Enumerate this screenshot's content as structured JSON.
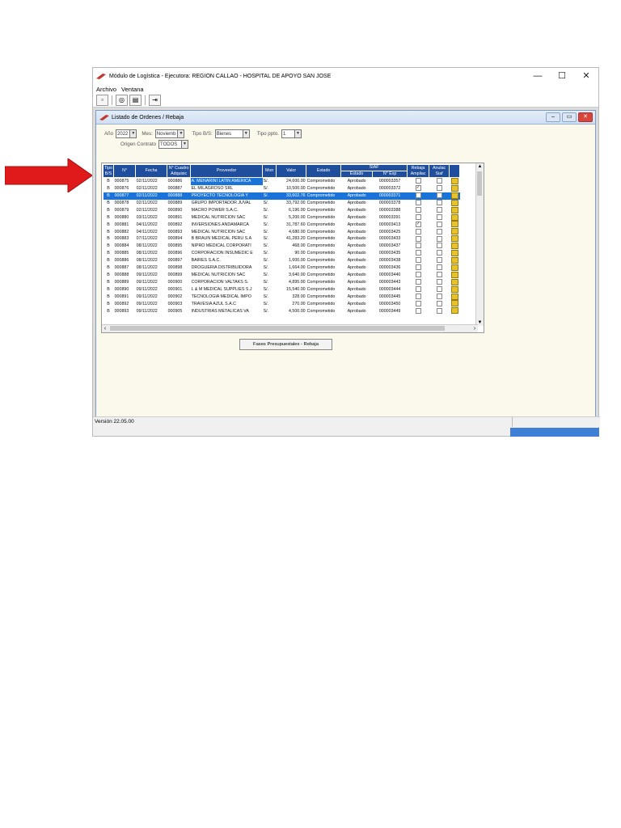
{
  "window": {
    "title": "Módulo de Logística - Ejecutora: REGION CALLAO - HOSPITAL DE APOYO SAN JOSE",
    "minimize": "—",
    "maximize": "☐",
    "close": "✕"
  },
  "menu": {
    "archivo": "Archivo",
    "ventana": "Ventana"
  },
  "child": {
    "title": "Listado de Ordenes / Rebaja"
  },
  "filters": {
    "anio_label": "Año",
    "anio_value": "2022",
    "mes_label": "Mes:",
    "mes_value": "Noviemb",
    "tipo_bs_label": "Tipo  B/S:",
    "tipo_bs_value": "Bienes",
    "tipo_ppto_label": "Tipo ppto.",
    "tipo_ppto_value": "1",
    "origen_label": "Origen Contrato",
    "origen_value": "TODOS"
  },
  "columns": {
    "tipo": "Tipo B/S",
    "numero": "N°",
    "fecha": "Fecha",
    "cuadro": "N° Cuadro Adquisic",
    "proveedor": "Proveedor",
    "mon": "Mon",
    "valor": "Valor",
    "estado": "Estado",
    "siaf": "SIAF",
    "siaf_estado": "Estado",
    "siaf_exp": "N° Exp",
    "rebaja": "Rebaja Ampliac",
    "anulac": "Anulac Siaf"
  },
  "rows": [
    {
      "tipo": "B",
      "num": "000875",
      "fecha": "02/11/2022",
      "cuadro": "000886",
      "prov": "A. MENARINI LATIN AMERICA",
      "mon": "S/.",
      "valor": "24,600.00",
      "estado": "Comprometido",
      "siaf_estado": "Aprobado",
      "exp": "000003357",
      "rebaja": false,
      "anulac": false
    },
    {
      "tipo": "B",
      "num": "000876",
      "fecha": "02/11/2022",
      "cuadro": "000887",
      "prov": "EL MILAGROSO SRL",
      "mon": "S/.",
      "valor": "10,500.00",
      "estado": "Comprometido",
      "siaf_estado": "Aprobado",
      "exp": "000003372",
      "rebaja": true,
      "anulac": false
    },
    {
      "tipo": "B",
      "num": "000877",
      "fecha": "02/11/2022",
      "cuadro": "000888",
      "prov": "PROYECTO TECNOLOGIA Y",
      "mon": "S/.",
      "valor": "33,602.76",
      "estado": "Comprometido",
      "siaf_estado": "Aprobado",
      "exp": "000003371",
      "rebaja": false,
      "anulac": false
    },
    {
      "tipo": "B",
      "num": "000878",
      "fecha": "02/11/2022",
      "cuadro": "000889",
      "prov": "GRUPO IMPORTADOR JUVAL",
      "mon": "S/.",
      "valor": "33,792.00",
      "estado": "Comprometido",
      "siaf_estado": "Aprobado",
      "exp": "000003378",
      "rebaja": false,
      "anulac": false
    },
    {
      "tipo": "B",
      "num": "000879",
      "fecha": "02/11/2022",
      "cuadro": "000890",
      "prov": "MACRO POWER S.A.C.",
      "mon": "S/.",
      "valor": "6,196.00",
      "estado": "Comprometido",
      "siaf_estado": "Aprobado",
      "exp": "000003388",
      "rebaja": false,
      "anulac": false
    },
    {
      "tipo": "B",
      "num": "000880",
      "fecha": "03/11/2022",
      "cuadro": "000891",
      "prov": "MEDICAL NUTRICION SAC",
      "mon": "S/.",
      "valor": "5,200.00",
      "estado": "Comprometido",
      "siaf_estado": "Aprobado",
      "exp": "000003391",
      "rebaja": false,
      "anulac": false
    },
    {
      "tipo": "B",
      "num": "000881",
      "fecha": "04/11/2022",
      "cuadro": "000892",
      "prov": "INVERSIONES ANDAMARCA",
      "mon": "S/.",
      "valor": "31,787.60",
      "estado": "Comprometido",
      "siaf_estado": "Aprobado",
      "exp": "000003413",
      "rebaja": true,
      "anulac": false
    },
    {
      "tipo": "B",
      "num": "000882",
      "fecha": "04/11/2022",
      "cuadro": "000893",
      "prov": "MEDICAL NUTRICION SAC",
      "mon": "S/.",
      "valor": "4,680.00",
      "estado": "Comprometido",
      "siaf_estado": "Aprobado",
      "exp": "000003425",
      "rebaja": false,
      "anulac": false
    },
    {
      "tipo": "B",
      "num": "000883",
      "fecha": "07/11/2022",
      "cuadro": "000894",
      "prov": "B BRAUN MEDICAL PERU S.A",
      "mon": "S/.",
      "valor": "41,283.20",
      "estado": "Comprometido",
      "siaf_estado": "Aprobado",
      "exp": "000003433",
      "rebaja": false,
      "anulac": false
    },
    {
      "tipo": "B",
      "num": "000884",
      "fecha": "08/11/2022",
      "cuadro": "000895",
      "prov": "NIPRO MEDICAL CORPORATI",
      "mon": "S/.",
      "valor": "468.00",
      "estado": "Comprometido",
      "siaf_estado": "Aprobado",
      "exp": "000003437",
      "rebaja": false,
      "anulac": false
    },
    {
      "tipo": "B",
      "num": "000885",
      "fecha": "08/11/2022",
      "cuadro": "000896",
      "prov": "CORPORACION INSUMEDIC E",
      "mon": "S/.",
      "valor": "90.00",
      "estado": "Comprometido",
      "siaf_estado": "Aprobado",
      "exp": "000003435",
      "rebaja": false,
      "anulac": false
    },
    {
      "tipo": "B",
      "num": "000886",
      "fecha": "08/11/2022",
      "cuadro": "000897",
      "prov": "BAIRES S.A.C.",
      "mon": "S/.",
      "valor": "1,600.00",
      "estado": "Comprometido",
      "siaf_estado": "Aprobado",
      "exp": "000003438",
      "rebaja": false,
      "anulac": false
    },
    {
      "tipo": "B",
      "num": "000887",
      "fecha": "08/11/2022",
      "cuadro": "000898",
      "prov": "DROGUERIA DISTRIBUIDORA",
      "mon": "S/.",
      "valor": "1,664.00",
      "estado": "Comprometido",
      "siaf_estado": "Aprobado",
      "exp": "000003436",
      "rebaja": false,
      "anulac": false
    },
    {
      "tipo": "B",
      "num": "000888",
      "fecha": "09/11/2022",
      "cuadro": "000899",
      "prov": "MEDICAL NUTRICION SAC",
      "mon": "S/.",
      "valor": "3,640.00",
      "estado": "Comprometido",
      "siaf_estado": "Aprobado",
      "exp": "000003440",
      "rebaja": false,
      "anulac": false
    },
    {
      "tipo": "B",
      "num": "000889",
      "fecha": "09/11/2022",
      "cuadro": "000900",
      "prov": "CORPORACION VALTAKS S.",
      "mon": "S/.",
      "valor": "4,895.00",
      "estado": "Comprometido",
      "siaf_estado": "Aprobado",
      "exp": "000003443",
      "rebaja": false,
      "anulac": false
    },
    {
      "tipo": "B",
      "num": "000890",
      "fecha": "09/11/2022",
      "cuadro": "000901",
      "prov": "L & M MEDICAL SUPPLIES S.J",
      "mon": "S/.",
      "valor": "15,540.00",
      "estado": "Comprometido",
      "siaf_estado": "Aprobado",
      "exp": "000003444",
      "rebaja": false,
      "anulac": false
    },
    {
      "tipo": "B",
      "num": "000891",
      "fecha": "09/11/2022",
      "cuadro": "000902",
      "prov": "TECNOLOGIA MEDICAL IMPO",
      "mon": "S/.",
      "valor": "328.00",
      "estado": "Comprometido",
      "siaf_estado": "Aprobado",
      "exp": "000003445",
      "rebaja": false,
      "anulac": false
    },
    {
      "tipo": "B",
      "num": "000892",
      "fecha": "09/11/2022",
      "cuadro": "000903",
      "prov": "TRAVESIA AZUL S.A.C",
      "mon": "S/.",
      "valor": "270.00",
      "estado": "Comprometido",
      "siaf_estado": "Aprobado",
      "exp": "000003450",
      "rebaja": false,
      "anulac": false
    },
    {
      "tipo": "B",
      "num": "000893",
      "fecha": "09/11/2022",
      "cuadro": "000905",
      "prov": "INDUSTRIAS METALICAS VA",
      "mon": "S/.",
      "valor": "4,500.00",
      "estado": "Comprometido",
      "siaf_estado": "Aprobado",
      "exp": "000003449",
      "rebaja": false,
      "anulac": false
    }
  ],
  "selected_row": 2,
  "highlight_row": 0,
  "button": {
    "fases": "Fases Presupuestales - Rebaja"
  },
  "status": {
    "version": "Versión 22.05.00"
  },
  "colors": {
    "header": "#1f4e9c",
    "selection": "#1a73d9",
    "arrow": "#e01a1a",
    "siaf_icon": "#e6c32a"
  },
  "icons": {
    "annotation_arrow": "red-arrow-icon",
    "app_logo": "app-logo-icon",
    "save": "save-icon",
    "view": "view-icon",
    "print": "print-icon",
    "exit": "exit-icon",
    "siaf": "siaf-folder-icon"
  }
}
